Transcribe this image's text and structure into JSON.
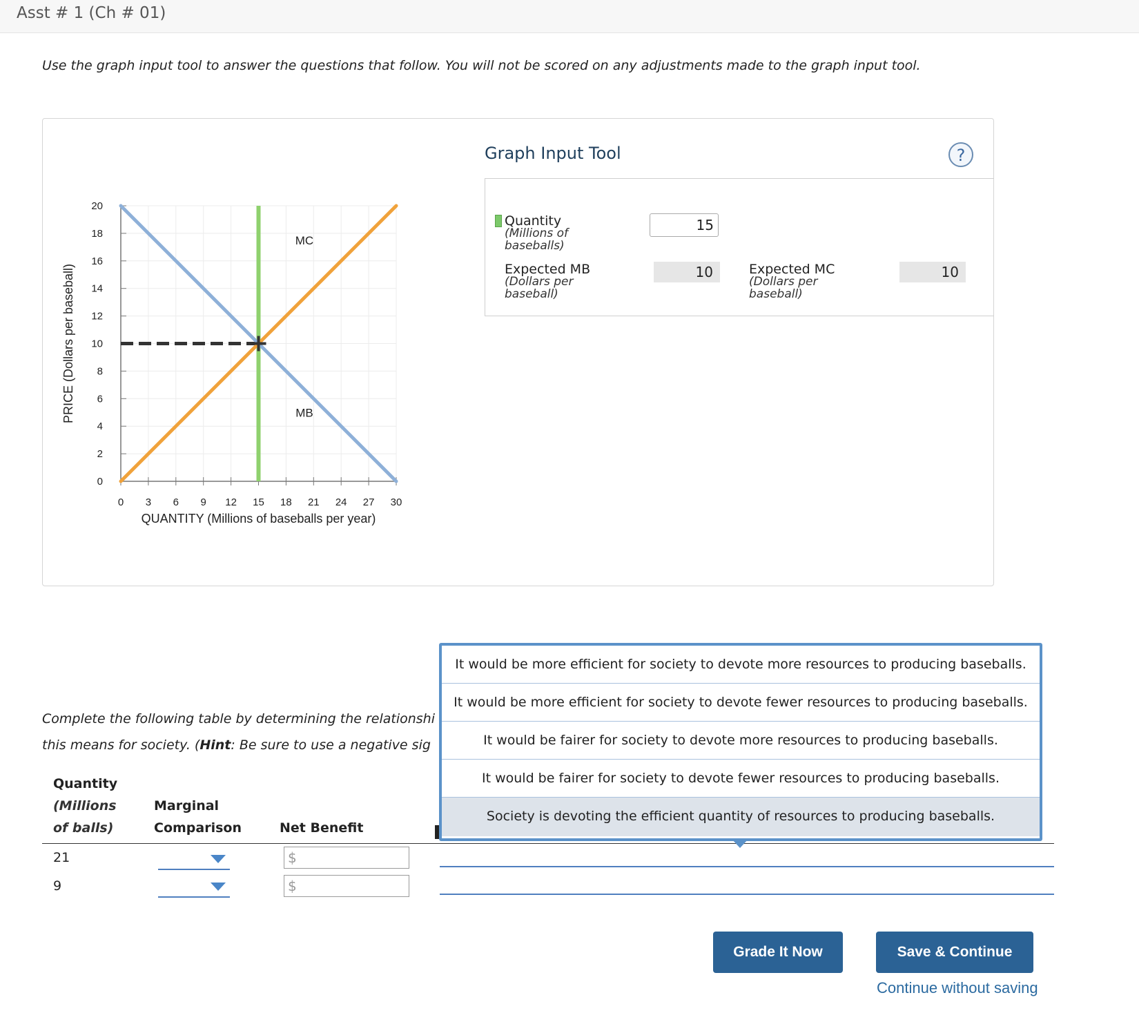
{
  "header": {
    "title": "Asst # 1 (Ch # 01)"
  },
  "instructions": "Use the graph input tool to answer the questions that follow. You will not be scored on any adjustments made to the graph input tool.",
  "graph_tool": {
    "title": "Graph Input Tool",
    "help_icon": "help-icon",
    "help_symbol": "?",
    "quantity_label": "Quantity",
    "quantity_sub": "(Millions of baseballs)",
    "quantity_value": "15",
    "mb_label": "Expected MB",
    "mb_sub": "(Dollars per baseball)",
    "mb_value": "10",
    "mc_label": "Expected MC",
    "mc_sub": "(Dollars per baseball)",
    "mc_value": "10"
  },
  "chart_data": {
    "type": "line",
    "xlabel": "QUANTITY (Millions of baseballs per year)",
    "ylabel": "PRICE (Dollars per baseball)",
    "xlim": [
      0,
      30
    ],
    "ylim": [
      0,
      20
    ],
    "x_ticks": [
      0,
      3,
      6,
      9,
      12,
      15,
      18,
      21,
      24,
      27,
      30
    ],
    "y_ticks": [
      0,
      2,
      4,
      6,
      8,
      10,
      12,
      14,
      16,
      18,
      20
    ],
    "grid": true,
    "series": [
      {
        "name": "MC",
        "color": "#f0a23b",
        "x": [
          0,
          30
        ],
        "y": [
          0,
          20
        ]
      },
      {
        "name": "MB",
        "color": "#8eb0d8",
        "x": [
          0,
          30
        ],
        "y": [
          20,
          0
        ]
      }
    ],
    "quantity_marker": {
      "x": 15,
      "color": "#8fd16e"
    },
    "price_marker": {
      "y": 10,
      "color": "#333333"
    }
  },
  "question": {
    "line1": "Complete the following table by determining the relationshi",
    "line2_pre": "this means for society. (",
    "line2_hint": "Hint",
    "line2_post": ": Be sure to use a negative sig"
  },
  "table": {
    "col_quantity": "Quantity",
    "col_quantity_sub1": "(Millions",
    "col_quantity_sub2": "of balls)",
    "col_marginal1": "Marginal",
    "col_marginal2": "Comparison",
    "col_net": "Net Benefit",
    "rows": [
      {
        "quantity": "21",
        "net_prefix": "$"
      },
      {
        "quantity": "9",
        "net_prefix": "$"
      }
    ]
  },
  "dropdown_options": [
    "It would be more efficient for society to devote more resources to producing baseballs.",
    "It would be more efficient for society to devote fewer resources to producing baseballs.",
    "It would be fairer for society to devote more resources to producing baseballs.",
    "It would be fairer for society to devote fewer resources to producing baseballs.",
    "Society is devoting the efficient quantity of resources to producing baseballs."
  ],
  "buttons": {
    "grade": "Grade It Now",
    "save": "Save & Continue",
    "continue_link": "Continue without saving"
  }
}
